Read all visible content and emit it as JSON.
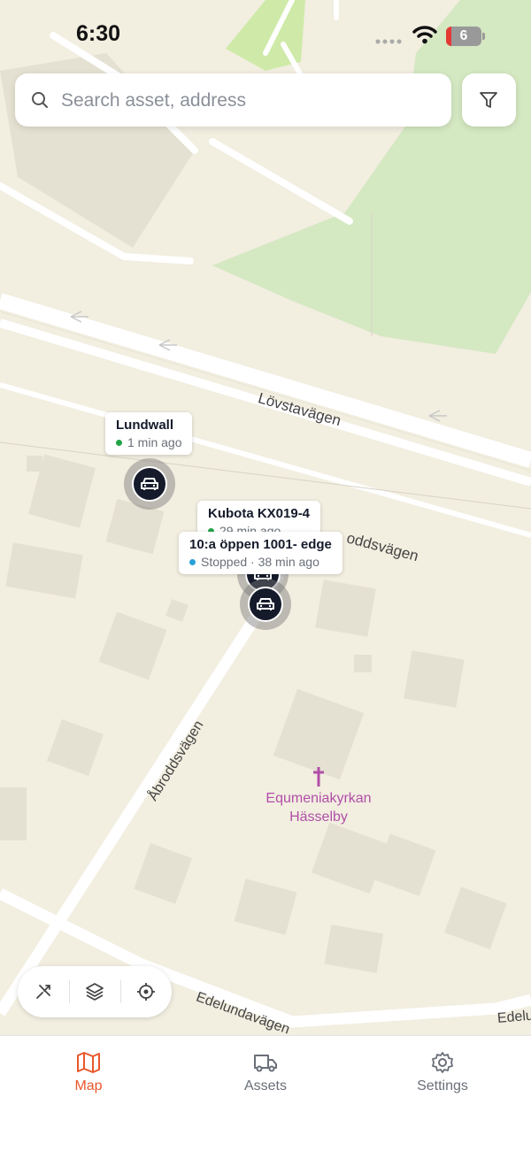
{
  "status_bar": {
    "time": "6:30",
    "battery": "6"
  },
  "search": {
    "placeholder": "Search asset, address"
  },
  "map": {
    "streets": {
      "lovstavagen": "Lövstavägen",
      "abroddsvagen": "Åbroddsvägen",
      "abroddsvagen_partial": "oddsvägen",
      "edelundavagen": "Edelundavägen",
      "edelund_partial": "Edelu"
    },
    "poi": {
      "line1": "Equmeniakyrkan",
      "line2": "Hässelby"
    },
    "assets": [
      {
        "name": "Lundwall",
        "status": "1 min ago",
        "status_color": "#22a347"
      },
      {
        "name": "Kubota KX019-4",
        "status": "29 min ago",
        "status_color": "#22a347"
      },
      {
        "name": "10:a öppen 1001- edge",
        "status": "Stopped · 38 min ago",
        "status_color": "#2a9fd8"
      }
    ]
  },
  "tabs": [
    {
      "label": "Map",
      "icon": "map-icon",
      "active": true
    },
    {
      "label": "Assets",
      "icon": "truck-icon",
      "active": false
    },
    {
      "label": "Settings",
      "icon": "gear-icon",
      "active": false
    }
  ],
  "colors": {
    "accent": "#e8582b",
    "marker": "#151b2b",
    "park": "#d4e8c2",
    "land": "#f2eee0"
  }
}
